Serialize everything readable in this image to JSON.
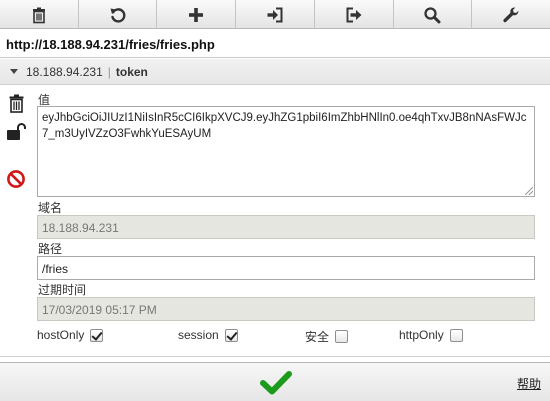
{
  "toolbar": {
    "buttons": [
      {
        "name": "delete-all",
        "icon": "trash-icon"
      },
      {
        "name": "refresh",
        "icon": "refresh-icon"
      },
      {
        "name": "add",
        "icon": "plus-icon"
      },
      {
        "name": "import",
        "icon": "import-icon"
      },
      {
        "name": "export",
        "icon": "export-icon"
      },
      {
        "name": "search",
        "icon": "search-icon"
      },
      {
        "name": "options",
        "icon": "wrench-icon"
      }
    ]
  },
  "url": "http://18.188.94.231/fries/fries.php",
  "cookie": {
    "domain": "18.188.94.231",
    "separator": "|",
    "name": "token"
  },
  "side_icons": [
    "trash-icon",
    "unlock-icon",
    "block-icon"
  ],
  "editor": {
    "value_label": "值",
    "value": "eyJhbGciOiJIUzI1NiIsInR5cCI6IkpXVCJ9.eyJhZG1pbiI6ImZhbHNlIn0.oe4qhTxvJB8nNAsFWJc7_m3UyIVZzO3FwhkYuESAyUM",
    "domain_label": "域名",
    "domain": "18.188.94.231",
    "path_label": "路径",
    "path": "/fries",
    "expires_label": "过期时间",
    "expires": "17/03/2019 05:17 PM"
  },
  "flags": {
    "hostonly": {
      "label": "hostOnly",
      "checked": true
    },
    "session": {
      "label": "session",
      "checked": true
    },
    "secure": {
      "label": "安全",
      "checked": false
    },
    "httponly": {
      "label": "httpOnly",
      "checked": false
    }
  },
  "footer": {
    "help_label": "帮助"
  },
  "colors": {
    "save_check": "#1c9a1c",
    "block_icon": "#d01818"
  }
}
